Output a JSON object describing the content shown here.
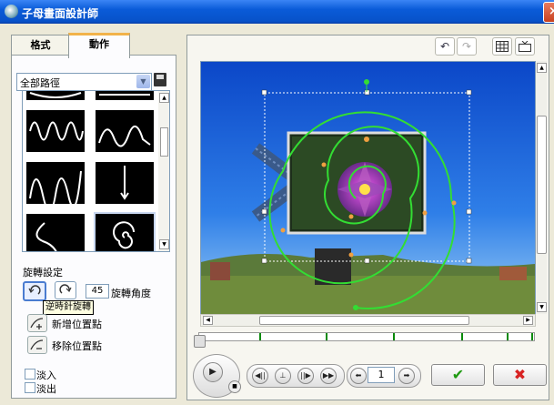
{
  "window": {
    "title": "子母畫面設計師",
    "close_glyph": "×"
  },
  "tabs": [
    {
      "label": "格式",
      "active": false
    },
    {
      "label": "動作",
      "active": true
    }
  ],
  "path_select": {
    "value": "全部路徑"
  },
  "rotation": {
    "section_label": "旋轉設定",
    "angle_value": "45",
    "angle_label": "旋轉角度",
    "tooltip": "逆時針旋轉"
  },
  "points": {
    "add_label": "新增位置點",
    "remove_label": "移除位置點"
  },
  "fade": {
    "fade_in_label": "淡入",
    "fade_out_label": "淡出"
  },
  "playback": {
    "page_value": "1"
  },
  "icons": {
    "undo": "undo-icon",
    "redo": "redo-icon",
    "grid": "grid-icon",
    "tv": "tv-icon",
    "ok": "checkmark-icon",
    "cancel": "x-icon"
  },
  "colors": {
    "titlebar": "#0a5bd8",
    "path_green": "#33dd33",
    "ok_green": "#1f9a12",
    "cancel_red": "#d82323"
  }
}
